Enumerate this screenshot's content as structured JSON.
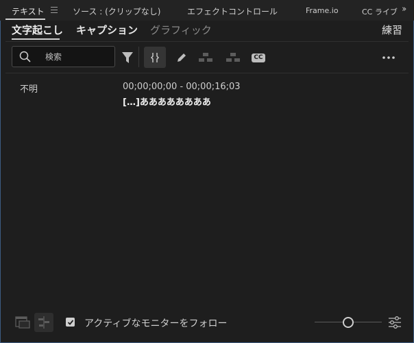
{
  "panel_tabs": [
    {
      "label": "テキスト"
    },
    {
      "label": "ソース : (クリップなし)"
    },
    {
      "label": "エフェクトコントロール"
    },
    {
      "label": "Frame.io"
    },
    {
      "label": "CC ライブ"
    }
  ],
  "sub_tabs": [
    {
      "label": "文字起こし"
    },
    {
      "label": "キャプション"
    },
    {
      "label": "グラフィック"
    }
  ],
  "practice_label": "練習",
  "search": {
    "placeholder": "検索",
    "value": ""
  },
  "toolbar": {
    "cc_label": "CC"
  },
  "transcript": {
    "speaker": "不明",
    "timecode": "00;00;00;00 - 00;00;16;03",
    "text": "[…]ああああああああ"
  },
  "bottom": {
    "follow_monitor_label": "アクティブなモニターをフォロー",
    "follow_monitor_checked": true,
    "zoom_level": 0.5
  },
  "colors": {
    "background": "#1e1e1e",
    "panel_border": "#3d5c82",
    "text": "#c8c8c8"
  }
}
